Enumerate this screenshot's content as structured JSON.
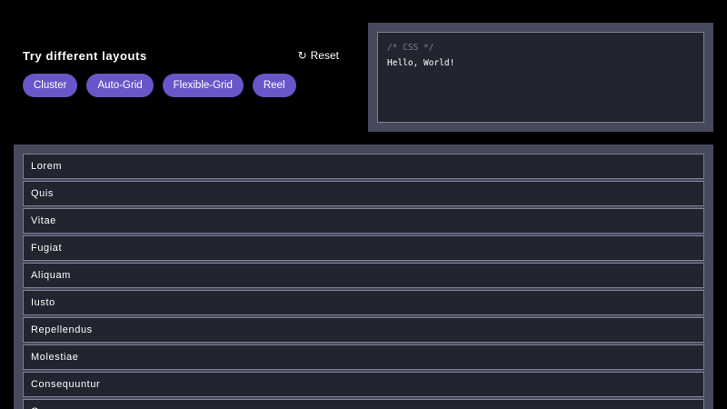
{
  "controls": {
    "title": "Try different layouts",
    "reset_label": "Reset",
    "reset_icon": "↻",
    "layouts": [
      {
        "label": "Cluster"
      },
      {
        "label": "Auto-Grid"
      },
      {
        "label": "Flexible-Grid"
      },
      {
        "label": "Reel"
      }
    ]
  },
  "code": {
    "comment": "/* CSS */",
    "content": "Hello, World!"
  },
  "preview": {
    "items": [
      {
        "label": "Lorem"
      },
      {
        "label": "Quis"
      },
      {
        "label": "Vitae"
      },
      {
        "label": "Fugiat"
      },
      {
        "label": "Aliquam"
      },
      {
        "label": "Iusto"
      },
      {
        "label": "Repellendus"
      },
      {
        "label": "Molestiae"
      },
      {
        "label": "Consequuntur"
      },
      {
        "label": "Quam"
      }
    ]
  },
  "colors": {
    "background": "#000000",
    "panel": "#464a5c",
    "surface": "#22242f",
    "border": "#7d8194",
    "accent": "#6a56c9"
  }
}
